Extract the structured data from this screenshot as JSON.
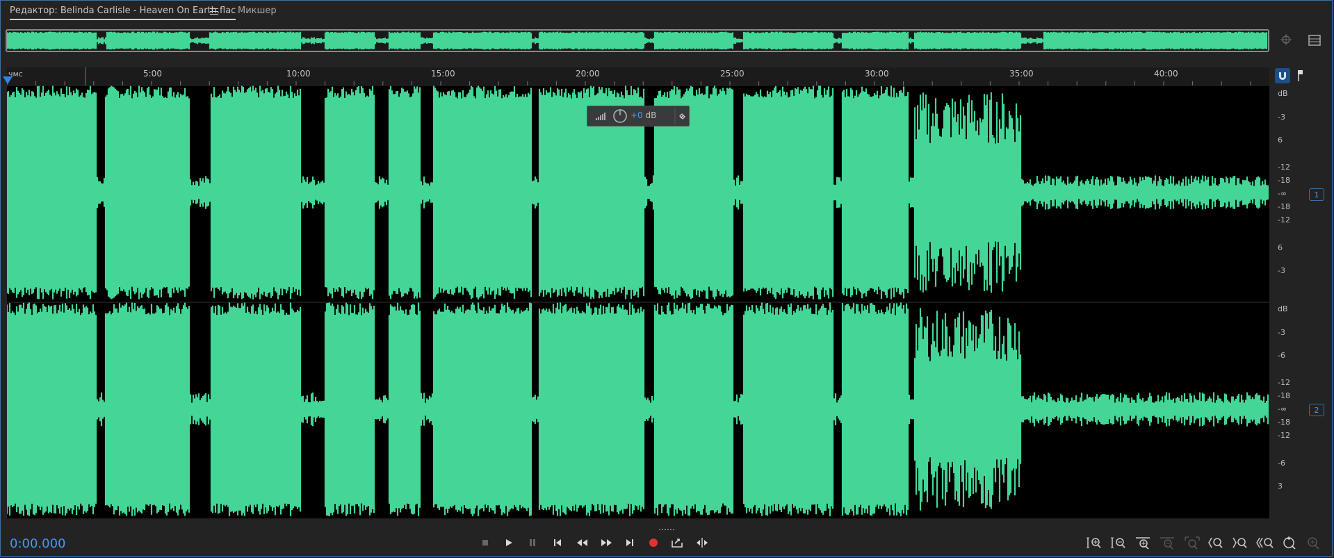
{
  "tabs": {
    "editor_label": "Редактор: Belinda Carlisle - Heaven On Earth.flac",
    "mixer_label": "Микшер"
  },
  "ruler": {
    "unit": "чмс",
    "ticks": [
      "5:00",
      "10:00",
      "15:00",
      "20:00",
      "25:00",
      "30:00",
      "35:00",
      "40:00"
    ]
  },
  "hud": {
    "gain_value": "+0",
    "gain_unit": "dB"
  },
  "channels": [
    {
      "id": "1",
      "scale": [
        "dB",
        "-3",
        "6",
        "-12",
        "-18",
        "-∞",
        "-18",
        "-12",
        "6",
        "-3"
      ]
    },
    {
      "id": "2",
      "scale": [
        "dB",
        "-3",
        "-6",
        "-12",
        "-18",
        "-∞",
        "-18",
        "-12",
        "-6",
        "3"
      ]
    }
  ],
  "timecode": "0:00.000",
  "colors": {
    "waveform": "#43d697",
    "accent": "#2f86e6",
    "record": "#e5312f"
  },
  "transport_icons": [
    "stop-icon",
    "play-icon",
    "pause-icon",
    "skip-to-start-icon",
    "rewind-icon",
    "fast-forward-icon",
    "skip-to-end-icon",
    "record-icon",
    "loop-output-icon",
    "skip-selection-icon"
  ],
  "zoom_icons": [
    "zoom-in-amplitude-icon",
    "zoom-out-amplitude-icon",
    "zoom-in-time-icon",
    "zoom-out-time-icon",
    "zoom-out-full-icon",
    "zoom-in-left-icon",
    "zoom-in-right-icon",
    "zoom-selection-icon",
    "zoom-reset-icon",
    "zoom-tool-icon"
  ]
}
